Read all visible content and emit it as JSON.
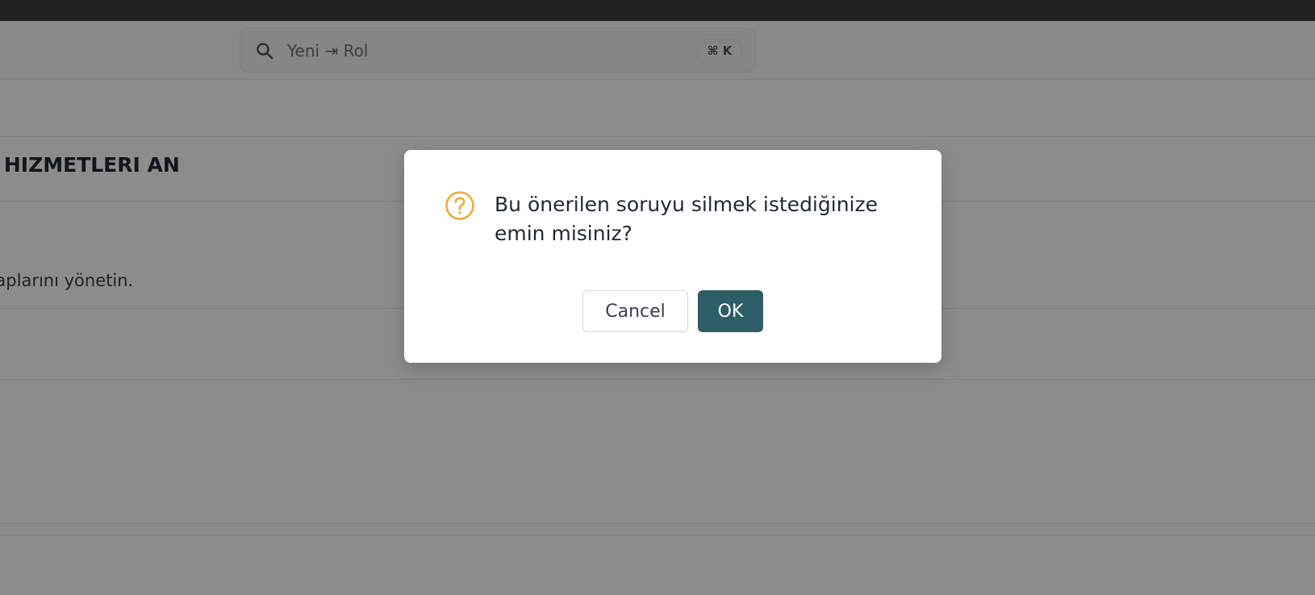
{
  "header": {
    "search": {
      "value": "Yeni ⇥ Rol",
      "shortcut": "⌘ K",
      "icon": "search-icon"
    }
  },
  "content": {
    "company_title": "IM HIZMETLERI AN",
    "description": "vaplarını yönetin."
  },
  "dialog": {
    "icon": "question-circle-icon",
    "message": "Bu önerilen soruyu silmek istediğinize emin misiniz?",
    "cancel_label": "Cancel",
    "ok_label": "OK"
  },
  "colors": {
    "accent": "#2d5e66",
    "warning": "#f0a93b",
    "overlay": "#8a8a8a"
  }
}
